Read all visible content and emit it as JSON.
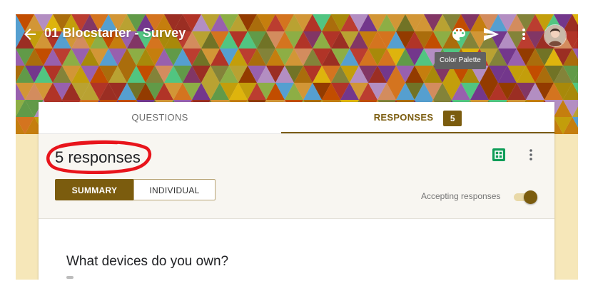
{
  "header": {
    "form_title": "01 Blocstarter - Survey",
    "icons": {
      "back": "arrow-left-icon",
      "palette": "palette-icon",
      "send": "send-icon",
      "more": "more-vert-icon",
      "avatar": "avatar"
    },
    "tooltip": "Color Palette"
  },
  "tabs": {
    "questions_label": "QUESTIONS",
    "responses_label": "RESPONSES",
    "responses_count": "5",
    "active": "responses"
  },
  "responses": {
    "title": "5 responses",
    "summary_label": "SUMMARY",
    "individual_label": "INDIVIDUAL",
    "active_view": "summary",
    "accepting_label": "Accepting responses",
    "accepting_on": true,
    "icons": {
      "sheets": "sheets-icon",
      "more": "more-vert-icon"
    }
  },
  "question": {
    "title": "What devices do you own?"
  },
  "colors": {
    "accent": "#7b5c0e",
    "page_background": "#f6e7b9",
    "annotation_circle": "#e8141b",
    "sheets_green": "#0f9d58",
    "tooltip_bg": "#616161"
  }
}
